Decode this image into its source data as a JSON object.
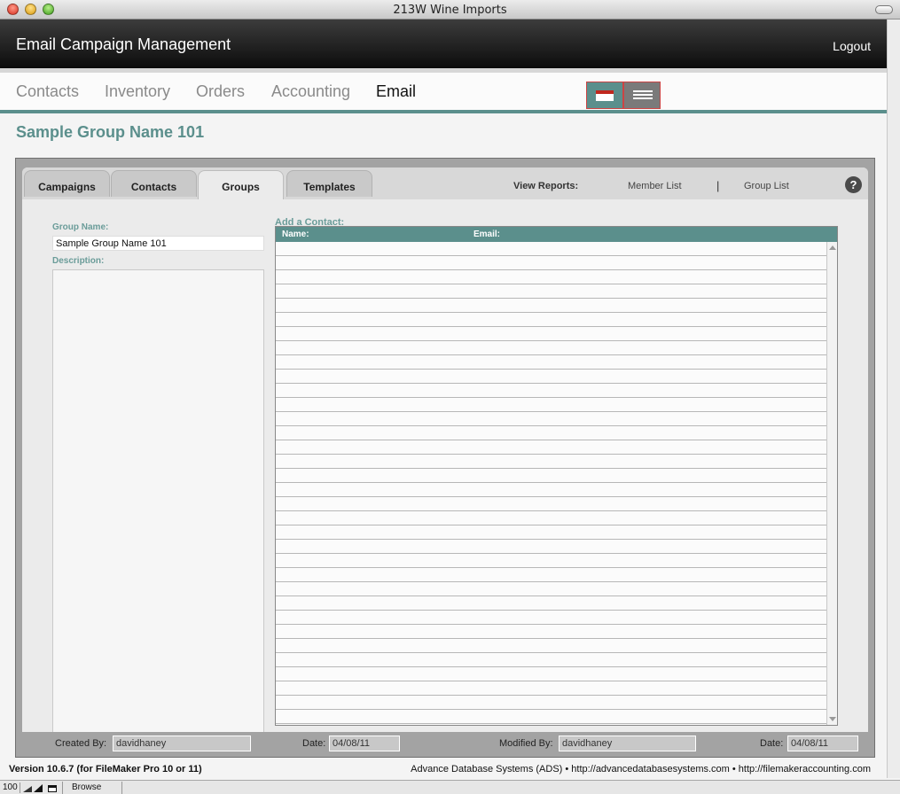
{
  "window": {
    "title": "213W Wine Imports"
  },
  "header": {
    "app_title": "Email Campaign Management",
    "logout_label": "Logout"
  },
  "nav": {
    "items": [
      "Contacts",
      "Inventory",
      "Orders",
      "Accounting",
      "Email"
    ],
    "active": "Email"
  },
  "view_toggle": {
    "form_icon": "form-view-icon",
    "list_icon": "list-view-icon"
  },
  "page": {
    "group_heading": "Sample Group Name 101"
  },
  "tabs": {
    "items": [
      "Campaigns",
      "Contacts",
      "Groups",
      "Templates"
    ],
    "active": "Groups"
  },
  "reports": {
    "label": "View Reports:",
    "member_list": "Member List",
    "separator": "|",
    "group_list": "Group List",
    "help": "?"
  },
  "form": {
    "group_name_label": "Group Name:",
    "group_name_value": "Sample Group Name 101",
    "description_label": "Description:",
    "description_value": ""
  },
  "contacts": {
    "add_label": "Add a Contact:",
    "columns": [
      "Name:",
      "Email:"
    ]
  },
  "meta": {
    "created_by_label": "Created By:",
    "created_by": "davidhaney",
    "created_date_label": "Date:",
    "created_date": "04/08/11",
    "modified_by_label": "Modified By:",
    "modified_by": "davidhaney",
    "modified_date_label": "Date:",
    "modified_date": "04/08/11"
  },
  "footer": {
    "version": "Version 10.6.7 (for FileMaker Pro 10 or 11)",
    "credits": "Advance Database Systems (ADS) • http://advancedatabasesystems.com • http://filemakeraccounting.com"
  },
  "status": {
    "zoom": "100",
    "mode": "Browse"
  },
  "colors": {
    "accent": "#5b8f8c",
    "header_bg": "#1e1e1e",
    "flag_red": "#c0281e"
  }
}
